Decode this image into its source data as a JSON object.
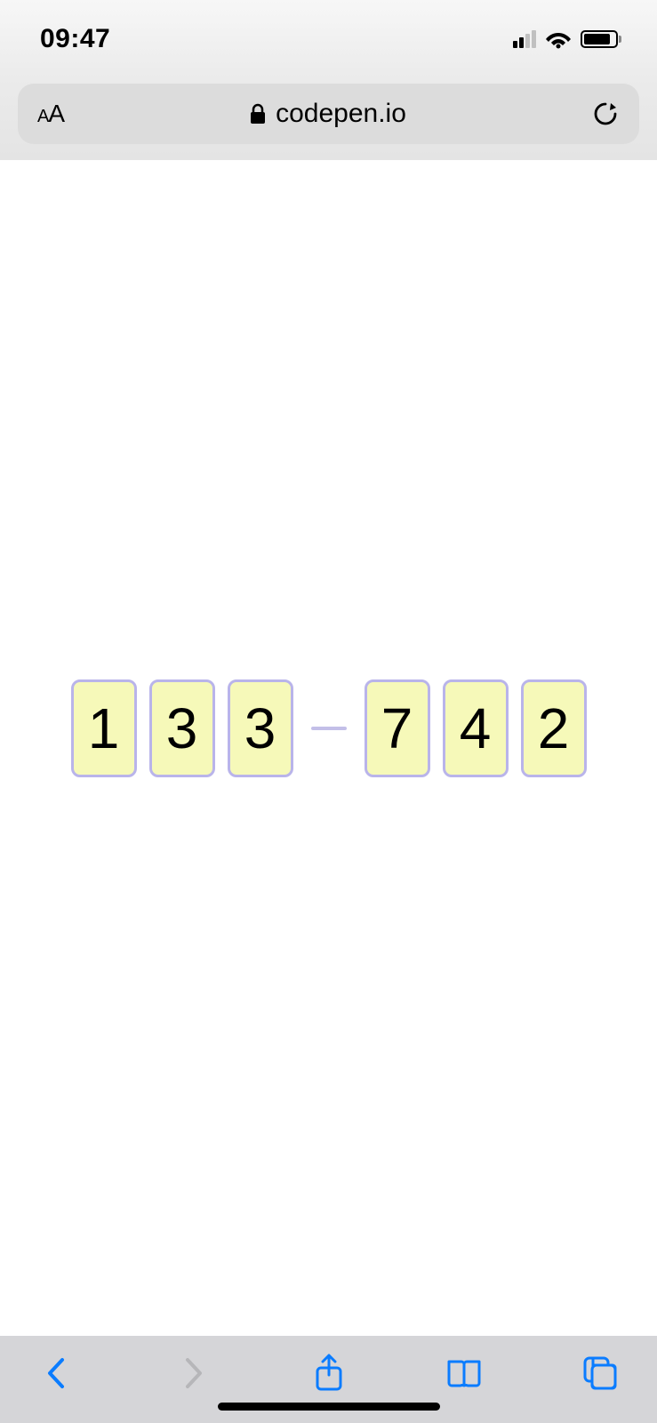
{
  "status": {
    "time": "09:47"
  },
  "browser": {
    "url": "codepen.io",
    "reader_button_small": "A",
    "reader_button_large": "A"
  },
  "otp": {
    "group1": [
      "1",
      "3",
      "3"
    ],
    "group2": [
      "7",
      "4",
      "2"
    ]
  }
}
